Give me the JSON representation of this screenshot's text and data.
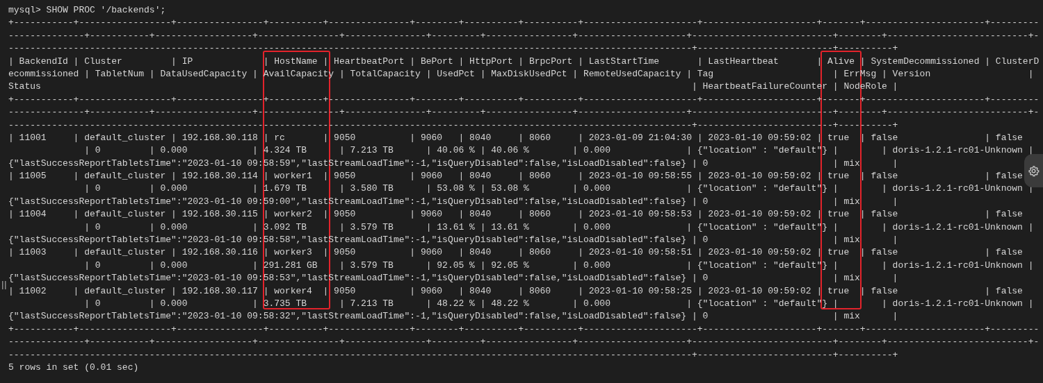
{
  "terminal": {
    "lines": [
      "mysql> SHOW PROC '/backends';",
      "+-----------+-----------------+----------------+----------+---------------+--------+----------+----------+---------------------+---------------------+-------+----------------------+---------",
      "--------------+-----------+------------------+---------------+---------------+---------+----------------+--------------------+--------------------------+--------+--------------------------+-",
      "------------------------------------------------------------------------------------------------------------------------------+-------------------------+----------+",
      "| BackendId | Cluster         | IP             | HostName | HeartbeatPort | BePort | HttpPort | BrpcPort | LastStartTime       | LastHeartbeat       | Alive | SystemDecommissioned | ClusterD",
      "ecommissioned | TabletNum | DataUsedCapacity | AvailCapacity | TotalCapacity | UsedPct | MaxDiskUsedPct | RemoteUsedCapacity | Tag                      | ErrMsg | Version                  |",
      "Status                                                                                                                        | HeartbeatFailureCounter | NodeRole |",
      "+-----------+-----------------+----------------+----------+---------------+--------+----------+----------+---------------------+---------------------+-------+----------------------+---------",
      "--------------+-----------+------------------+---------------+---------------+---------+----------------+--------------------+--------------------------+--------+--------------------------+-",
      "------------------------------------------------------------------------------------------------------------------------------+-------------------------+----------+",
      "| 11001     | default_cluster | 192.168.30.118 | rc       | 9050          | 9060   | 8040     | 8060     | 2023-01-09 21:04:30 | 2023-01-10 09:59:02 | true  | false                | false",
      "              | 0         | 0.000            | 4.324 TB      | 7.213 TB      | 40.06 % | 40.06 %        | 0.000              | {\"location\" : \"default\"} |        | doris-1.2.1-rc01-Unknown |",
      "{\"lastSuccessReportTabletsTime\":\"2023-01-10 09:58:59\",\"lastStreamLoadTime\":-1,\"isQueryDisabled\":false,\"isLoadDisabled\":false} | 0                       | mix      |",
      "| 11005     | default_cluster | 192.168.30.114 | worker1  | 9050          | 9060   | 8040     | 8060     | 2023-01-10 09:58:55 | 2023-01-10 09:59:02 | true  | false                | false",
      "              | 0         | 0.000            | 1.679 TB      | 3.580 TB      | 53.08 % | 53.08 %        | 0.000              | {\"location\" : \"default\"} |        | doris-1.2.1-rc01-Unknown |",
      "{\"lastSuccessReportTabletsTime\":\"2023-01-10 09:59:00\",\"lastStreamLoadTime\":-1,\"isQueryDisabled\":false,\"isLoadDisabled\":false} | 0                       | mix      |",
      "| 11004     | default_cluster | 192.168.30.115 | worker2  | 9050          | 9060   | 8040     | 8060     | 2023-01-10 09:58:53 | 2023-01-10 09:59:02 | true  | false                | false",
      "              | 0         | 0.000            | 3.092 TB      | 3.579 TB      | 13.61 % | 13.61 %        | 0.000              | {\"location\" : \"default\"} |        | doris-1.2.1-rc01-Unknown |",
      "{\"lastSuccessReportTabletsTime\":\"2023-01-10 09:58:58\",\"lastStreamLoadTime\":-1,\"isQueryDisabled\":false,\"isLoadDisabled\":false} | 0                       | mix      |",
      "| 11003     | default_cluster | 192.168.30.116 | worker3  | 9050          | 9060   | 8040     | 8060     | 2023-01-10 09:58:51 | 2023-01-10 09:59:02 | true  | false                | false",
      "              | 0         | 0.000            | 291.281 GB    | 3.579 TB      | 92.05 % | 92.05 %        | 0.000              | {\"location\" : \"default\"} |        | doris-1.2.1-rc01-Unknown |",
      "{\"lastSuccessReportTabletsTime\":\"2023-01-10 09:58:53\",\"lastStreamLoadTime\":-1,\"isQueryDisabled\":false,\"isLoadDisabled\":false} | 0                       | mix      |",
      "| 11002     | default_cluster | 192.168.30.117 | worker4  | 9050          | 9060   | 8040     | 8060     | 2023-01-10 09:58:25 | 2023-01-10 09:59:02 | true  | false                | false",
      "              | 0         | 0.000            | 3.735 TB      | 7.213 TB      | 48.22 % | 48.22 %        | 0.000              | {\"location\" : \"default\"} |        | doris-1.2.1-rc01-Unknown |",
      "{\"lastSuccessReportTabletsTime\":\"2023-01-10 09:58:32\",\"lastStreamLoadTime\":-1,\"isQueryDisabled\":false,\"isLoadDisabled\":false} | 0                       | mix      |",
      "+-----------+-----------------+----------------+----------+---------------+--------+----------+----------+---------------------+---------------------+-------+----------------------+---------",
      "--------------+-----------+------------------+---------------+---------------+---------+----------------+--------------------+--------------------------+--------+--------------------------+-",
      "------------------------------------------------------------------------------------------------------------------------------+-------------------------+----------+",
      "5 rows in set (0.01 sec)"
    ]
  }
}
